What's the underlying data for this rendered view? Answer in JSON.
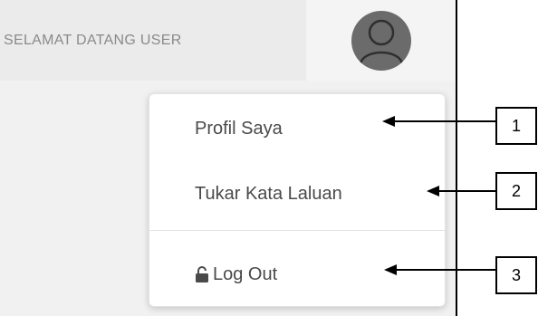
{
  "header": {
    "welcome_text": "SELAMAT DATANG USER",
    "avatar_icon": "user-avatar-icon"
  },
  "dropdown": {
    "items": [
      {
        "label": "Profil Saya"
      },
      {
        "label": "Tukar Kata Laluan"
      },
      {
        "label": "Log Out",
        "icon": "unlock-icon"
      }
    ]
  },
  "callouts": [
    "1",
    "2",
    "3"
  ],
  "colors": {
    "header_bg": "#ebebeb",
    "avatar_bg": "#6b6b6b",
    "text": "#4a4a4a",
    "welcome_text": "#8a8a8a"
  }
}
